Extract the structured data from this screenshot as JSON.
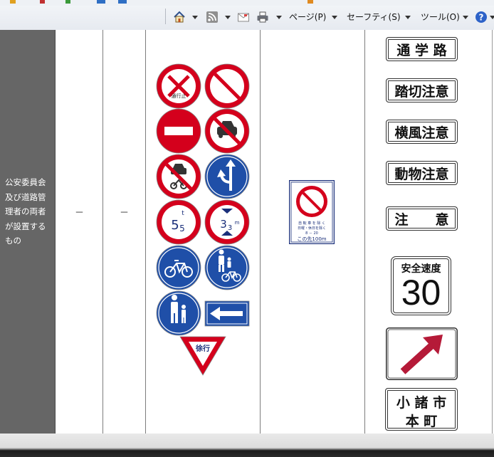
{
  "toolbar": {
    "home_icon": "home-icon",
    "feeds_icon": "rss-feed-icon",
    "mail_icon": "mail-icon",
    "print_icon": "printer-icon",
    "page_menu": "ページ(P)",
    "safety_menu": "セーフティ(S)",
    "tools_menu": "ツール(O)",
    "help_icon": "help-icon"
  },
  "table": {
    "owner_label": "公安委員会及び道路管理者の両者が設置するもの",
    "col2_value": "－",
    "col3_value": "－"
  },
  "regulatory_signs": [
    {
      "name": "no-entry-closed-sign",
      "text": "通行止"
    },
    {
      "name": "no-vehicles-sign"
    },
    {
      "name": "do-not-enter-sign"
    },
    {
      "name": "no-cars-sign"
    },
    {
      "name": "no-cars-and-motorcycles-sign"
    },
    {
      "name": "straight-or-left-turn-sign"
    },
    {
      "name": "weight-limit-sign",
      "value": "5",
      "sub": "5",
      "unit": "t"
    },
    {
      "name": "height-limit-sign",
      "value": "3",
      "sub": "3",
      "unit": "m"
    },
    {
      "name": "bicycles-only-sign"
    },
    {
      "name": "pedestrians-and-bicycles-sign"
    },
    {
      "name": "pedestrians-only-sign"
    },
    {
      "name": "one-way-sign"
    },
    {
      "name": "slow-down-sign",
      "text": "徐行"
    }
  ],
  "supplementary_sign": {
    "line1": "自 転 車 を 除 く",
    "line2": "日曜・休日を除く",
    "line3": "8 － 20",
    "distance": "この先100m"
  },
  "text_signs": {
    "school_route": "通 学 路",
    "railroad_caution": "踏切注意",
    "crosswind_caution": "横風注意",
    "animal_caution": "動物注意",
    "caution": "注　　意",
    "safe_speed_label": "安全速度",
    "safe_speed_value": "30",
    "place_line1": "小 諸 市",
    "place_line2": "本 町"
  },
  "colors": {
    "sign_red": "#d4001c",
    "sign_blue": "#1f4fa8",
    "arrow_red": "#b51a38",
    "owner_cell_bg": "#666666"
  }
}
